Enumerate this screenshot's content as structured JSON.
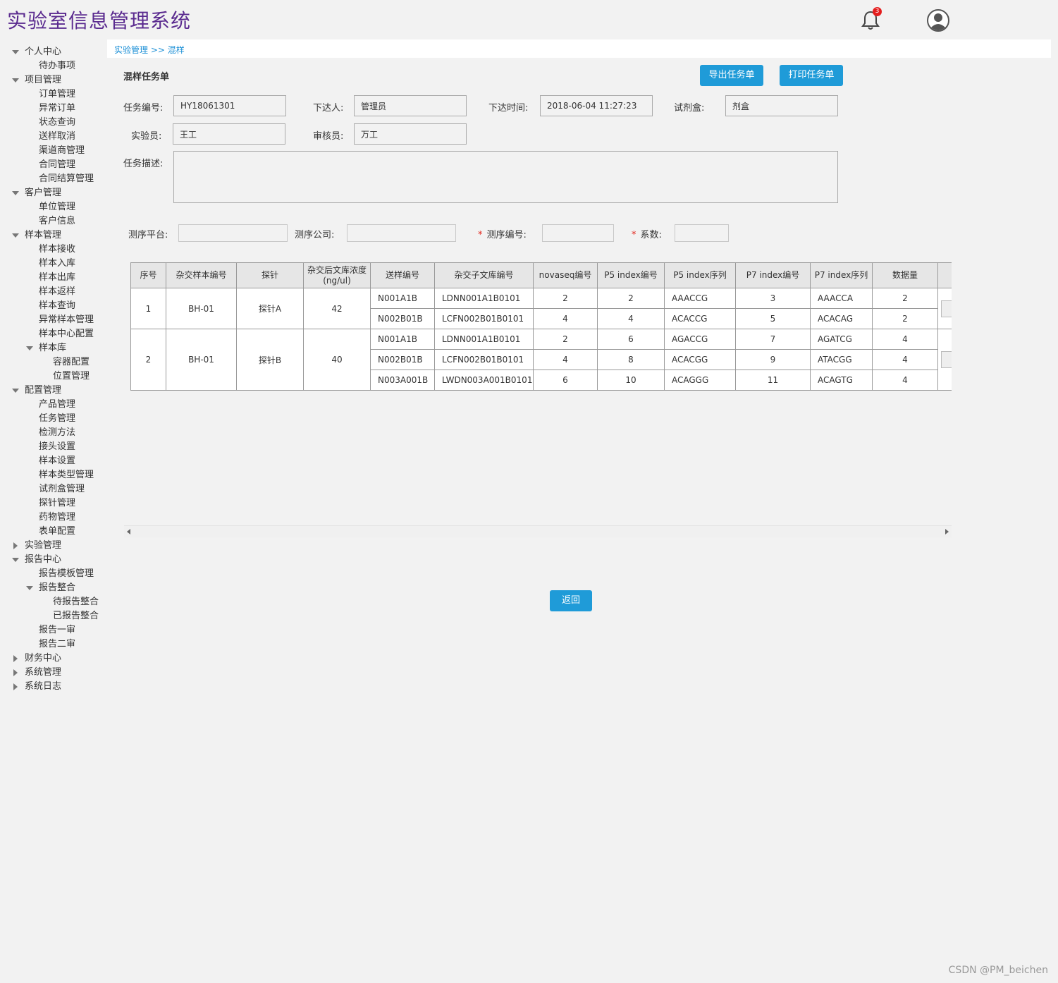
{
  "app": {
    "title": "实验室信息管理系统",
    "notification_count": "3"
  },
  "sidebar": {
    "items": [
      {
        "label": "个人中心",
        "level": 0,
        "state": "open"
      },
      {
        "label": "待办事项",
        "level": 1
      },
      {
        "label": "项目管理",
        "level": 0,
        "state": "open"
      },
      {
        "label": "订单管理",
        "level": 1
      },
      {
        "label": "异常订单",
        "level": 1
      },
      {
        "label": "状态查询",
        "level": 1
      },
      {
        "label": "送样取消",
        "level": 1
      },
      {
        "label": "渠道商管理",
        "level": 1
      },
      {
        "label": "合同管理",
        "level": 1
      },
      {
        "label": "合同结算管理",
        "level": 1
      },
      {
        "label": "客户管理",
        "level": 0,
        "state": "open"
      },
      {
        "label": "单位管理",
        "level": 1
      },
      {
        "label": "客户信息",
        "level": 1
      },
      {
        "label": "样本管理",
        "level": 0,
        "state": "open"
      },
      {
        "label": "样本接收",
        "level": 1
      },
      {
        "label": "样本入库",
        "level": 1
      },
      {
        "label": "样本出库",
        "level": 1
      },
      {
        "label": "样本返样",
        "level": 1
      },
      {
        "label": "样本查询",
        "level": 1
      },
      {
        "label": "异常样本管理",
        "level": 1
      },
      {
        "label": "样本中心配置",
        "level": 1
      },
      {
        "label": "样本库",
        "level": 1,
        "state": "open"
      },
      {
        "label": "容器配置",
        "level": 2
      },
      {
        "label": "位置管理",
        "level": 2
      },
      {
        "label": "配置管理",
        "level": 0,
        "state": "open"
      },
      {
        "label": "产品管理",
        "level": 1
      },
      {
        "label": "任务管理",
        "level": 1
      },
      {
        "label": "检测方法",
        "level": 1
      },
      {
        "label": "接头设置",
        "level": 1
      },
      {
        "label": "样本设置",
        "level": 1
      },
      {
        "label": "样本类型管理",
        "level": 1
      },
      {
        "label": "试剂盒管理",
        "level": 1
      },
      {
        "label": "探针管理",
        "level": 1
      },
      {
        "label": "药物管理",
        "level": 1
      },
      {
        "label": "表单配置",
        "level": 1
      },
      {
        "label": "实验管理",
        "level": 0,
        "state": "closed"
      },
      {
        "label": "报告中心",
        "level": 0,
        "state": "open"
      },
      {
        "label": "报告模板管理",
        "level": 1
      },
      {
        "label": "报告整合",
        "level": 1,
        "state": "open"
      },
      {
        "label": "待报告整合",
        "level": 2
      },
      {
        "label": "已报告整合",
        "level": 2
      },
      {
        "label": "报告一审",
        "level": 1
      },
      {
        "label": "报告二审",
        "level": 1
      },
      {
        "label": "财务中心",
        "level": 0,
        "state": "closed"
      },
      {
        "label": "系统管理",
        "level": 0,
        "state": "closed"
      },
      {
        "label": "系统日志",
        "level": 0,
        "state": "closed"
      }
    ]
  },
  "breadcrumb": "实验管理 >> 混样",
  "page_title": "混样任务单",
  "buttons": {
    "export": "导出任务单",
    "print": "打印任务单",
    "back": "返回"
  },
  "form": {
    "task_no_label": "任务编号:",
    "task_no": "HY18061301",
    "issuer_label": "下达人:",
    "issuer": "管理员",
    "issue_time_label": "下达时间:",
    "issue_time": "2018-06-04 11:27:23",
    "kit_label": "试剂盒:",
    "kit": "剂盒",
    "experimenter_label": "实验员:",
    "experimenter": "王工",
    "reviewer_label": "审核员:",
    "reviewer": "万工",
    "desc_label": "任务描述:",
    "desc": "",
    "platform_label": "测序平台:",
    "platform": "",
    "company_label": "测序公司:",
    "company": "",
    "seq_no_label": "测序编号:",
    "seq_no": "",
    "coef_label": "系数:",
    "coef": "",
    "required_mark": "*"
  },
  "table": {
    "headers": [
      "序号",
      "杂交样本编号",
      "探针",
      "杂交后文库浓度(ng/ul)",
      "送样编号",
      "杂交子文库编号",
      "novaseq编号",
      "P5 index编号",
      "P5 index序列",
      "P7 index编号",
      "P7 index序列",
      "数据量"
    ],
    "groups": [
      {
        "seq": "1",
        "hyb_sample": "BH-01",
        "probe": "探针A",
        "conc": "42",
        "rows": [
          {
            "sample": "N001A1B",
            "sublib": "LDNN001A1B0101",
            "novaseq": "2",
            "p5no": "2",
            "p5seq": "AAACCG",
            "p7no": "3",
            "p7seq": "AAACCA",
            "data": "2"
          },
          {
            "sample": "N002B01B",
            "sublib": "LCFN002B01B0101",
            "novaseq": "4",
            "p5no": "4",
            "p5seq": "ACACCG",
            "p7no": "5",
            "p7seq": "ACACAG",
            "data": "2"
          }
        ]
      },
      {
        "seq": "2",
        "hyb_sample": "BH-01",
        "probe": "探针B",
        "conc": "40",
        "rows": [
          {
            "sample": "N001A1B",
            "sublib": "LDNN001A1B0101",
            "novaseq": "2",
            "p5no": "6",
            "p5seq": "AGACCG",
            "p7no": "7",
            "p7seq": "AGATCG",
            "data": "4"
          },
          {
            "sample": "N002B01B",
            "sublib": "LCFN002B01B0101",
            "novaseq": "4",
            "p5no": "8",
            "p5seq": "ACACGG",
            "p7no": "9",
            "p7seq": "ATACGG",
            "data": "4"
          },
          {
            "sample": "N003A001B",
            "sublib": "LWDN003A001B0101",
            "novaseq": "6",
            "p5no": "10",
            "p5seq": "ACAGGG",
            "p7no": "11",
            "p7seq": "ACAGTG",
            "data": "4"
          }
        ]
      }
    ]
  },
  "watermark": "CSDN @PM_beichen",
  "colors": {
    "title": "#5a2a8f",
    "accent": "#1f9bd8",
    "link": "#1b8fd6",
    "badge": "#e41e1e"
  }
}
